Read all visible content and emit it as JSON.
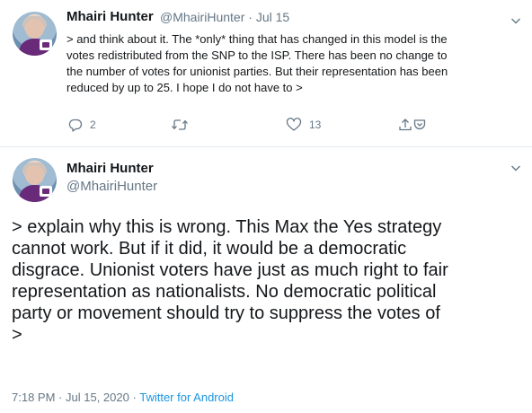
{
  "tweet1": {
    "author_name": "Mhairi Hunter",
    "handle": "@MhairiHunter",
    "separator": "·",
    "date": "Jul 15",
    "text_lines": [
      "> and think about it. The *only* thing that has changed in this model is the",
      "votes redistributed from the SNP to the ISP.  There has been no change to",
      "the number of votes for unionist parties. But their representation has been",
      "reduced by up to 25. I hope I do not have to >"
    ],
    "reply_count": "2",
    "retweet_count": "",
    "like_count": "13",
    "icons": [
      "reply-icon",
      "retweet-icon",
      "like-icon",
      "share-icon",
      "chevron-down-icon"
    ]
  },
  "tweet2": {
    "author_name": "Mhairi Hunter",
    "handle": "@MhairiHunter",
    "text_lines": [
      "> explain why this is wrong. This Max the Yes strategy",
      "cannot work. But if it did, it would be a democratic",
      "disgrace. Unionist voters have just as much right to fair",
      "representation as nationalists. No democratic political",
      "party or movement should try to suppress the votes of",
      ">"
    ],
    "time": "7:18 PM",
    "separator1": "·",
    "date": "Jul 15, 2020",
    "separator2": "·",
    "source": "Twitter for Android"
  },
  "colors": {
    "text": "#14171a",
    "secondary": "#657786",
    "link": "#1b95e0",
    "divider": "#e6ecf0"
  }
}
